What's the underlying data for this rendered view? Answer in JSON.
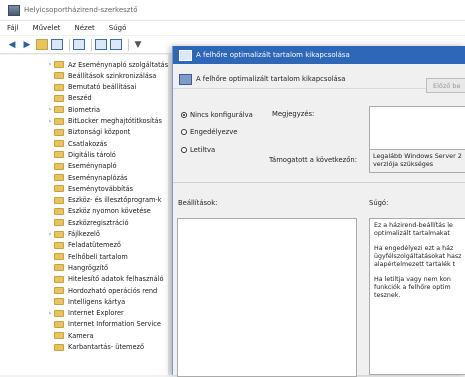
{
  "window": {
    "title": "Helyicsoportházirend-szerkesztő"
  },
  "menubar": {
    "items": [
      "Fájl",
      "Művelet",
      "Nézet",
      "Súgó"
    ]
  },
  "toolbar": {
    "icons": [
      "back-icon",
      "forward-icon",
      "folder-up-icon",
      "show-tree-icon",
      "properties-icon",
      "help-icon",
      "view-icon",
      "filter-icon"
    ]
  },
  "tree": {
    "selected_index": 23,
    "items": [
      {
        "label": "Az Eseménynapló szolgáltatás",
        "expandable": true
      },
      {
        "label": "Beállítások szinkronizálása",
        "expandable": false
      },
      {
        "label": "Bemutató beállításai",
        "expandable": false
      },
      {
        "label": "Beszéd",
        "expandable": false
      },
      {
        "label": "Biometria",
        "expandable": true
      },
      {
        "label": "BitLocker meghajtótitkosítás",
        "expandable": true
      },
      {
        "label": "Biztonsági központ",
        "expandable": false
      },
      {
        "label": "Csatlakozás",
        "expandable": false
      },
      {
        "label": "Digitális tároló",
        "expandable": false
      },
      {
        "label": "Eseménynapló",
        "expandable": false
      },
      {
        "label": "Eseménynaplózás",
        "expandable": false
      },
      {
        "label": "Eseménytovábbítás",
        "expandable": false
      },
      {
        "label": "Eszköz- és illesztőprogram-k",
        "expandable": false
      },
      {
        "label": "Eszköz nyomon követése",
        "expandable": false
      },
      {
        "label": "Eszközregisztráció",
        "expandable": false
      },
      {
        "label": "Fájlkezelő",
        "expandable": true
      },
      {
        "label": "Feladatütemező",
        "expandable": false
      },
      {
        "label": "Felhőbeli tartalom",
        "expandable": false
      },
      {
        "label": "Hangrögzítő",
        "expandable": false
      },
      {
        "label": "Hitelesítő adatok felhasználó",
        "expandable": false
      },
      {
        "label": "Hordozható operációs rend",
        "expandable": false
      },
      {
        "label": "Intelligens kártya",
        "expandable": false
      },
      {
        "label": "Internet Explorer",
        "expandable": true
      },
      {
        "label": "Internet Information Service",
        "expandable": false
      },
      {
        "label": "Kamera",
        "expandable": false
      },
      {
        "label": "Karbantartás- ütemező",
        "expandable": false
      }
    ]
  },
  "dialog": {
    "title": "A felhőre optimalizált tartalom kikapcsolása",
    "header": "A felhőre optimalizált tartalom kikapcsolása",
    "prev_button": "Előző be",
    "radios": [
      {
        "label": "Nincs konfigurálva",
        "checked": true
      },
      {
        "label": "Engedélyezve",
        "checked": false
      },
      {
        "label": "Letiltva",
        "checked": false
      }
    ],
    "comment_label": "Megjegyzés:",
    "supported_label": "Támogatott a következőn:",
    "supported_value": [
      "Legalább Windows Server 2",
      "verziója szükséges"
    ],
    "options_label": "Beállítások:",
    "help_label": "Súgó:",
    "help_paragraphs": [
      [
        "Ez a házirend-beállítás le",
        "optimalizált tartalmakat"
      ],
      [
        "Ha engedélyezi ezt a ház",
        "ügyfélszolgáltatásokat hasz",
        "alapértelmezett tartalék t"
      ],
      [
        "Ha letiltja vagy nem kon",
        "funkciók a felhőre optim",
        "tesznek."
      ]
    ]
  }
}
